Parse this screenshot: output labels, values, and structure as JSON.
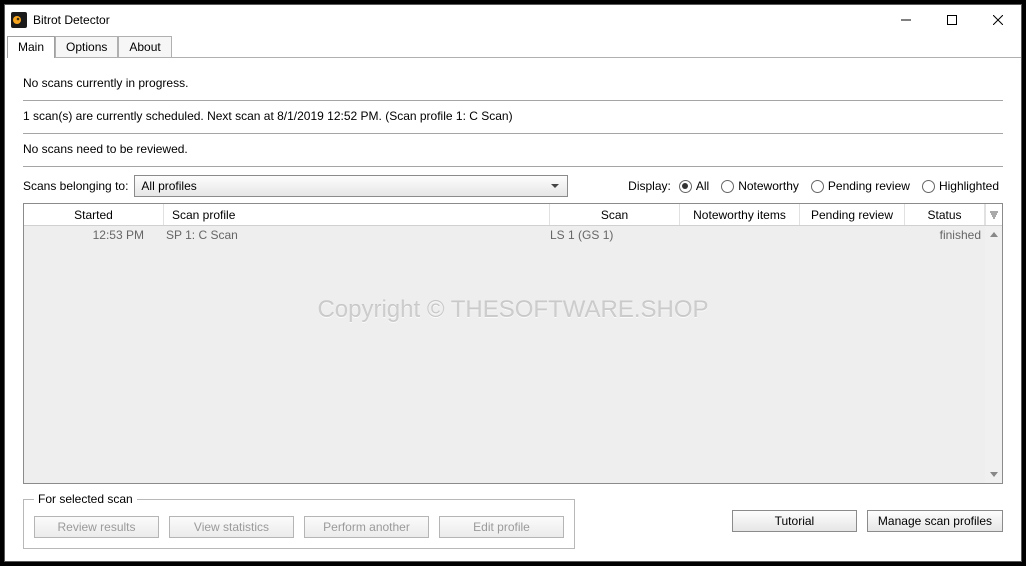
{
  "window": {
    "title": "Bitrot Detector"
  },
  "tabs": {
    "main": "Main",
    "options": "Options",
    "about": "About"
  },
  "status": {
    "no_scans_progress": "No scans currently in progress.",
    "scheduled": "1 scan(s) are currently scheduled.  Next scan at 8/1/2019 12:52 PM.  (Scan profile 1: C Scan)",
    "no_review": "No scans need to be reviewed."
  },
  "filter": {
    "label": "Scans belonging to:",
    "profile_select": "All profiles",
    "display_label": "Display:",
    "opt_all": "All",
    "opt_noteworthy": "Noteworthy",
    "opt_pending": "Pending review",
    "opt_highlighted": "Highlighted"
  },
  "table": {
    "headers": {
      "started": "Started",
      "profile": "Scan profile",
      "scan": "Scan",
      "noteworthy": "Noteworthy items",
      "pending": "Pending review",
      "status": "Status"
    },
    "rows": [
      {
        "started": "12:53 PM",
        "profile": "SP 1: C Scan",
        "scan": "LS 1 (GS 1)",
        "noteworthy": "",
        "pending": "",
        "status": "finished"
      }
    ]
  },
  "selected_group": {
    "legend": "For selected scan",
    "review": "Review results",
    "stats": "View statistics",
    "perform": "Perform another",
    "edit": "Edit profile"
  },
  "bottom": {
    "tutorial": "Tutorial",
    "manage": "Manage scan profiles"
  },
  "watermark": "Copyright © THESOFTWARE.SHOP"
}
